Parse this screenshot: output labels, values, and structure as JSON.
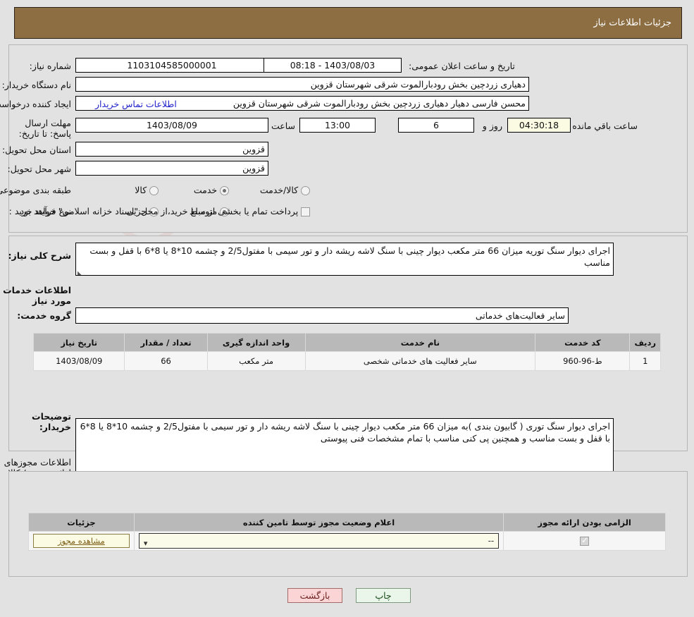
{
  "header": {
    "title": "جزئیات اطلاعات نیاز"
  },
  "watermark": {
    "text": "AriaTender.net"
  },
  "top": {
    "need_number_label": "شماره نیاز:",
    "need_number_value": "1103104585000001",
    "public_announce_label": "تاریخ و ساعت اعلان عمومی:",
    "public_announce_value": "1403/08/03 - 08:18",
    "buyer_org_label": "نام دستگاه خریدار:",
    "buyer_org_value": "دهیاری زردچین بخش رودبارالموت شرقی شهرستان قزوین",
    "creator_label": "ایجاد کننده درخواست:",
    "creator_value": "محسن فارسی دهیار دهیاری زردچین بخش رودبارالموت شرقی شهرستان قزوین",
    "contact_link": "اطلاعات تماس خریدار",
    "deadline_label": "مهلت ارسال پاسخ: تا تاریخ:",
    "deadline_date": "1403/08/09",
    "hour_label": "ساعت",
    "deadline_time": "13:00",
    "days_value": "6",
    "days_label": "روز و",
    "countdown_value": "04:30:18",
    "countdown_label": "ساعت باقي مانده",
    "province_label": "استان محل تحویل:",
    "province_value": "قزوین",
    "city_label": "شهر محل تحویل:",
    "city_value": "قزوین",
    "classification_label": "طبقه بندی موضوعی:",
    "classification_options": [
      "کالا",
      "خدمت",
      "کالا/خدمت"
    ],
    "classification_selected": "خدمت",
    "process_label": "نوع فرآیند خرید :",
    "process_options": [
      "جزیی",
      "متوسط"
    ],
    "process_selected": "متوسط",
    "treasury_text": "پرداخت تمام یا بخشی از مبلغ خرید،از محل \"اسناد خزانه اسلامی\" خواهد بود.",
    "treasury_checked": false
  },
  "mid": {
    "general_desc_label": "شرح کلی نیاز:",
    "general_desc_value": "اجرای دیوار سنگ توریه میزان 66 متر مکعب دیوار چینی با سنگ لاشه ریشه دار و تور سیمی با مفتول2/5 و چشمه 10*8 یا 8*6 با قفل و بست مناسب",
    "services_section_title": "اطلاعات خدمات مورد نیاز",
    "service_group_label": "گروه خدمت:",
    "service_group_value": "سایر فعالیت‌های خدماتی",
    "table": {
      "headers": [
        "ردیف",
        "کد خدمت",
        "نام خدمت",
        "واحد اندازه گیری",
        "تعداد / مقدار",
        "تاریخ نیاز"
      ],
      "rows": [
        {
          "row": "1",
          "code": "ط-96-960",
          "name": "سایر فعالیت های خدماتی شخصی",
          "unit": "متر مکعب",
          "qty": "66",
          "date": "1403/08/09"
        }
      ]
    },
    "buyer_notes_label": "توضیحات خریدار:",
    "buyer_notes_value": "اجرای دیوار سنگ توری ( گابیون بندی )به میزان 66 متر مکعب دیوار چینی با سنگ لاشه ریشه دار و تور سیمی با مفتول2/5 و چشمه 10*8 یا 8*6 با قفل و بست مناسب و همچنین پی کنی مناسب با تمام مشخصات فنی پیوستی"
  },
  "permits": {
    "section_title": "اطلاعات مجوزهای ارائه خدمت / کالا",
    "headers": [
      "الزامی بودن ارائه مجوز",
      "اعلام وضعیت مجوز توسط تامین کننده",
      "جزئیات"
    ],
    "rows": [
      {
        "required_checked": true,
        "status_value": "--",
        "detail_button": "مشاهده مجوز"
      }
    ]
  },
  "footer": {
    "print_label": "چاپ",
    "back_label": "بازگشت"
  }
}
